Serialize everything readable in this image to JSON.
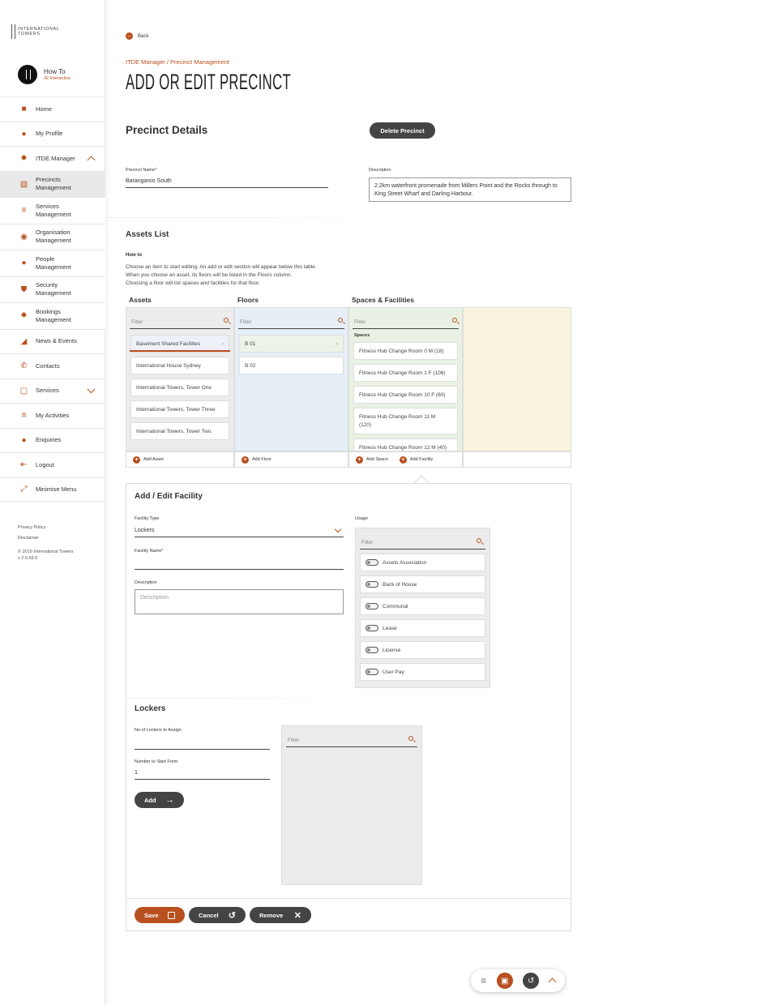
{
  "brand": {
    "logo_text_line1": "INTERNATIONAL",
    "logo_text_line2": "TOWERS"
  },
  "user": {
    "name": "How To",
    "org": "42 Interactive"
  },
  "sidebar": {
    "items": [
      {
        "label": "Home",
        "icon": "home-icon"
      },
      {
        "label": "My Profile",
        "icon": "person-icon"
      },
      {
        "label": "ITDE Manager",
        "icon": "cogs-icon"
      },
      {
        "label": "Precincts Management",
        "icon": "document-gear-icon"
      },
      {
        "label": "Services Management",
        "icon": "list-gear-icon"
      },
      {
        "label": "Organisation Management",
        "icon": "org-gear-icon"
      },
      {
        "label": "People Management",
        "icon": "people-gear-icon"
      },
      {
        "label": "Security Management",
        "icon": "shield-gear-icon"
      },
      {
        "label": "Bookings Management",
        "icon": "bookings-gear-icon"
      },
      {
        "label": "News & Events",
        "icon": "megaphone-icon"
      },
      {
        "label": "Contacts",
        "icon": "phone-icon"
      },
      {
        "label": "Services",
        "icon": "cube-icon"
      },
      {
        "label": "My Activities",
        "icon": "activities-list-icon"
      },
      {
        "label": "Enquiries",
        "icon": "alert-circle-icon"
      },
      {
        "label": "Logout",
        "icon": "logout-icon"
      },
      {
        "label": "Minimise Menu",
        "icon": "minimise-icon"
      }
    ],
    "privacy": "Privacy Policy",
    "disclaimer": "Disclaimer",
    "copyright": "© 2019 International Towers",
    "version": "v 2.0.69.0"
  },
  "header": {
    "back": "Back",
    "breadcrumb": "ITDE Manager / Precinct Management",
    "title": "ADD OR EDIT PRECINCT"
  },
  "precinct": {
    "heading": "Precinct Details",
    "delete_label": "Delete Precinct",
    "name_label": "Precinct Name*",
    "name_value": "Barangaroo South",
    "desc_label": "Description",
    "desc_value": "2.2km waterfront promenade from Millers Point and the Rocks through to King Street Wharf and Darling Harbour."
  },
  "assets": {
    "heading": "Assets List",
    "howto_title": "How to",
    "howto_line1": "Choose an item to start editing. An add or edit section will appear below this table.",
    "howto_line2": "When you choose an asset, its floors will be listed in the Floors column.",
    "howto_line3": "Choosing a floor will list spaces and facilities for that floor.",
    "col_assets": "Assets",
    "col_floors": "Floors",
    "col_spaces": "Spaces & Facilities",
    "filter_placeholder": "Filter",
    "asset_items": [
      "Basement Shared Facilities",
      "International House Sydney",
      "International Towers, Tower One",
      "International Towers, Tower Three",
      "International Towers, Tower Two"
    ],
    "floor_items": [
      "B 01",
      "B 02"
    ],
    "spaces_label": "Spaces",
    "space_items": [
      "Fitness Hub Change Room 0 M (18)",
      "Fitness Hub Change Room 1 F (106)",
      "Fitness Hub Change Room 10 F (60)",
      "Fitness Hub Change Room 11 M (120)",
      "Fitness Hub Change Room 12 M (40)"
    ],
    "add_asset": "Add Asset",
    "add_floor": "Add Floor",
    "add_space": "Add Space",
    "add_facility": "Add Facility"
  },
  "facility": {
    "heading": "Add / Edit Facility",
    "type_label": "Facility Type",
    "type_value": "Lockers",
    "name_label": "Facility Name*",
    "desc_label": "Description",
    "desc_placeholder": "Description",
    "usage_label": "Usage",
    "usage_filter": "Filter",
    "usage_items": [
      "Assets Association",
      "Back of House",
      "Communal",
      "Lease",
      "License",
      "User Pay"
    ]
  },
  "lockers": {
    "heading": "Lockers",
    "count_label": "No of Lockers to Assign",
    "start_label": "Number to Start From",
    "start_value": "1",
    "add_label": "Add",
    "filter": "Filter"
  },
  "actions": {
    "save": "Save",
    "cancel": "Cancel",
    "remove": "Remove"
  },
  "colors": {
    "accent": "#b8501f",
    "dark_button": "#444444",
    "assets_bg": "#ececec",
    "floors_bg": "#e6eef6",
    "spaces_bg": "#e9f1e4",
    "extra_bg": "#f9f4dd"
  }
}
